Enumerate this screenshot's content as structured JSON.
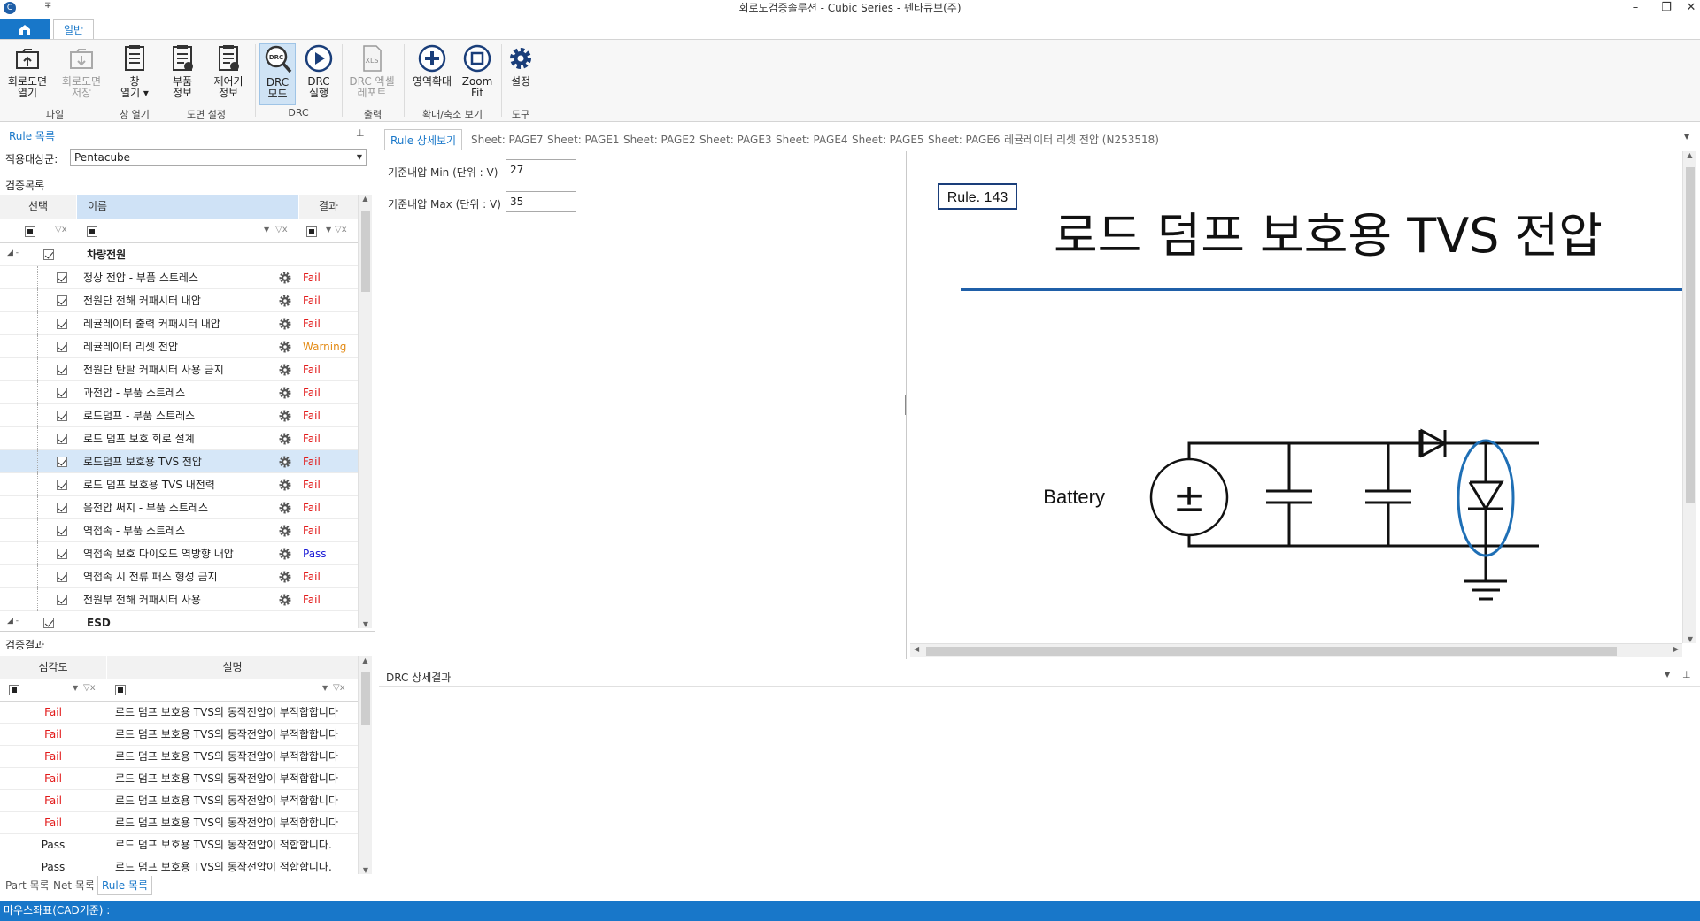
{
  "window": {
    "title": "회로도검증솔루션 - Cubic Series - 펜타큐브(주)",
    "minimize": "–",
    "restore": "❐",
    "close": "✕",
    "quick_access": "∓"
  },
  "ribbon": {
    "file_tab": "",
    "main_tab": "일반",
    "buttons": [
      {
        "label": "회로도면\n열기",
        "icon": "open-folder-icon"
      },
      {
        "label": "회로도면\n저장",
        "icon": "save-folder-icon"
      },
      {
        "label": "창\n열기 ▾",
        "icon": "window-list-icon"
      },
      {
        "label": "부품\n정보",
        "icon": "part-info-icon"
      },
      {
        "label": "제어기\n정보",
        "icon": "controller-info-icon"
      },
      {
        "label": "DRC\n모드",
        "icon": "drc-mode-icon",
        "badge": "DRC"
      },
      {
        "label": "DRC\n실행",
        "icon": "play-icon"
      },
      {
        "label": "DRC 엑셀\n레포트",
        "icon": "excel-icon",
        "badge": "XLS"
      },
      {
        "label": "영역확대",
        "icon": "zoom-in-icon"
      },
      {
        "label": "Zoom\nFit",
        "icon": "zoom-fit-icon"
      },
      {
        "label": "설정",
        "icon": "gear-icon"
      }
    ],
    "groups": [
      "파일",
      "창 열기",
      "도면 설정",
      "DRC",
      "출력",
      "확대/축소 보기",
      "도구"
    ]
  },
  "left_panel": {
    "title": "Rule 목록",
    "pin": "⊥",
    "target_label": "적용대상군:",
    "target_value": "Pentacube",
    "verify_list_label": "검증목록",
    "columns": {
      "select": "선택",
      "name": "이름",
      "result": "결과"
    },
    "groups": [
      {
        "name": "차량전원"
      },
      {
        "name": "ESD"
      }
    ],
    "rules": [
      {
        "name": "정상 전압 - 부품 스트레스",
        "result": "Fail",
        "status": "fail"
      },
      {
        "name": "전원단 전해 커패시터 내압",
        "result": "Fail",
        "status": "fail"
      },
      {
        "name": "레귤레이터 출력 커패시터 내압",
        "result": "Fail",
        "status": "fail"
      },
      {
        "name": "레귤레이터 리셋 전압",
        "result": "Warning",
        "status": "warn"
      },
      {
        "name": "전원단 탄탈 커패시터 사용 금지",
        "result": "Fail",
        "status": "fail"
      },
      {
        "name": "과전압 - 부품 스트레스",
        "result": "Fail",
        "status": "fail"
      },
      {
        "name": "로드덤프 - 부품 스트레스",
        "result": "Fail",
        "status": "fail"
      },
      {
        "name": "로드 덤프 보호 회로 설계",
        "result": "Fail",
        "status": "fail"
      },
      {
        "name": "로드덤프 보호용 TVS 전압",
        "result": "Fail",
        "status": "fail",
        "selected": true
      },
      {
        "name": "로드 덤프 보호용 TVS 내전력",
        "result": "Fail",
        "status": "fail"
      },
      {
        "name": "음전압 써지 - 부품 스트레스",
        "result": "Fail",
        "status": "fail"
      },
      {
        "name": "역접속 - 부품 스트레스",
        "result": "Fail",
        "status": "fail"
      },
      {
        "name": "역접속 보호 다이오드 역방향 내압",
        "result": "Pass",
        "status": "pass"
      },
      {
        "name": "역접속 시 전류 패스 형성 금지",
        "result": "Fail",
        "status": "fail"
      },
      {
        "name": "전원부 전해 커패시터 사용",
        "result": "Fail",
        "status": "fail"
      }
    ],
    "results_label": "검증결과",
    "results_columns": {
      "severity": "심각도",
      "desc": "설명"
    },
    "results": [
      {
        "severity": "Fail",
        "desc": "로드 덤프 보호용 TVS의 동작전압이 부적합합니다",
        "status": "fail"
      },
      {
        "severity": "Fail",
        "desc": "로드 덤프 보호용 TVS의 동작전압이 부적합합니다",
        "status": "fail"
      },
      {
        "severity": "Fail",
        "desc": "로드 덤프 보호용 TVS의 동작전압이 부적합합니다",
        "status": "fail"
      },
      {
        "severity": "Fail",
        "desc": "로드 덤프 보호용 TVS의 동작전압이 부적합합니다",
        "status": "fail"
      },
      {
        "severity": "Fail",
        "desc": "로드 덤프 보호용 TVS의 동작전압이 부적합합니다",
        "status": "fail"
      },
      {
        "severity": "Fail",
        "desc": "로드 덤프 보호용 TVS의 동작전압이 부적합합니다",
        "status": "fail"
      },
      {
        "severity": "Pass",
        "desc": "로드 덤프 보호용 TVS의 동작전압이 적합합니다.",
        "status": "passblack"
      },
      {
        "severity": "Pass",
        "desc": "로드 덤프 보호용 TVS의 동작전압이 적합합니다.",
        "status": "passblack"
      }
    ],
    "bottom_tabs": [
      "Part 목록",
      "Net 목록",
      "Rule 목록"
    ]
  },
  "doc_tabs": [
    "Rule 상세보기",
    "Sheet: PAGE7",
    "Sheet: PAGE1",
    "Sheet: PAGE2",
    "Sheet: PAGE3",
    "Sheet: PAGE4",
    "Sheet: PAGE5",
    "Sheet: PAGE6",
    "레귤레이터 리셋 전압 (N253518)"
  ],
  "rule_detail": {
    "min_label": "기준내압 Min (단위 : V)",
    "min_value": "27",
    "max_label": "기준내압 Max (단위 : V)",
    "max_value": "35",
    "rule_id": "Rule. 143",
    "rule_title": "로드 덤프 보호용 TVS 전압",
    "battery_label": "Battery",
    "plus_minus": "±"
  },
  "drc_panel": {
    "title": "DRC 상세결과"
  },
  "status_bar": {
    "text": "마우스좌표(CAD기준) :"
  },
  "colors": {
    "accent": "#1877c9",
    "fail": "#e21919",
    "warning": "#e38a14",
    "pass": "#1a1ad6",
    "selected_row": "#d6e7f8"
  }
}
